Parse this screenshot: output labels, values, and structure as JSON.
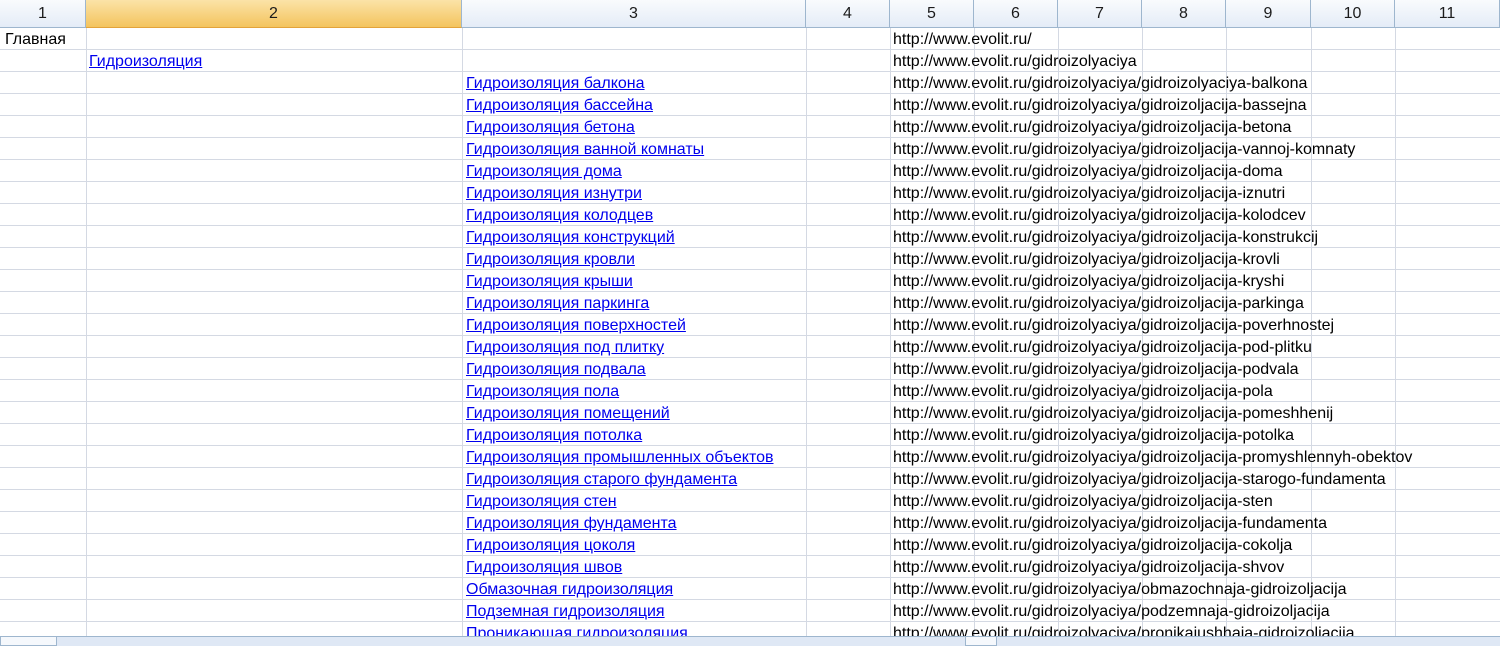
{
  "columns": [
    "1",
    "2",
    "3",
    "4",
    "5",
    "6",
    "7",
    "8",
    "9",
    "10",
    "11"
  ],
  "selected_column": "2",
  "rows": [
    {
      "c1": "Главная",
      "c2": "",
      "c3": "",
      "url": "http://www.evolit.ru/"
    },
    {
      "c1": "",
      "c2": "Гидроизоляция",
      "c3": "",
      "url": "http://www.evolit.ru/gidroizolyaciya"
    },
    {
      "c1": "",
      "c2": "",
      "c3": "Гидроизоляция балкона",
      "url": "http://www.evolit.ru/gidroizolyaciya/gidroizolyaciya-balkona"
    },
    {
      "c1": "",
      "c2": "",
      "c3": "Гидроизоляция бассейна",
      "url": "http://www.evolit.ru/gidroizolyaciya/gidroizoljacija-bassejna"
    },
    {
      "c1": "",
      "c2": "",
      "c3": "Гидроизоляция бетона",
      "url": "http://www.evolit.ru/gidroizolyaciya/gidroizoljacija-betona"
    },
    {
      "c1": "",
      "c2": "",
      "c3": "Гидроизоляция ванной комнаты",
      "url": "http://www.evolit.ru/gidroizolyaciya/gidroizoljacija-vannoj-komnaty"
    },
    {
      "c1": "",
      "c2": "",
      "c3": "Гидроизоляция дома",
      "url": "http://www.evolit.ru/gidroizolyaciya/gidroizoljacija-doma"
    },
    {
      "c1": "",
      "c2": "",
      "c3": "Гидроизоляция изнутри",
      "url": "http://www.evolit.ru/gidroizolyaciya/gidroizoljacija-iznutri"
    },
    {
      "c1": "",
      "c2": "",
      "c3": "Гидроизоляция колодцев",
      "url": "http://www.evolit.ru/gidroizolyaciya/gidroizoljacija-kolodcev"
    },
    {
      "c1": "",
      "c2": "",
      "c3": "Гидроизоляция конструкций",
      "url": "http://www.evolit.ru/gidroizolyaciya/gidroizoljacija-konstrukcij"
    },
    {
      "c1": "",
      "c2": "",
      "c3": "Гидроизоляция кровли",
      "url": "http://www.evolit.ru/gidroizolyaciya/gidroizoljacija-krovli"
    },
    {
      "c1": "",
      "c2": "",
      "c3": "Гидроизоляция крыши",
      "url": "http://www.evolit.ru/gidroizolyaciya/gidroizoljacija-kryshi"
    },
    {
      "c1": "",
      "c2": "",
      "c3": "Гидроизоляция паркинга",
      "url": "http://www.evolit.ru/gidroizolyaciya/gidroizoljacija-parkinga"
    },
    {
      "c1": "",
      "c2": "",
      "c3": "Гидроизоляция поверхностей",
      "url": "http://www.evolit.ru/gidroizolyaciya/gidroizoljacija-poverhnostej"
    },
    {
      "c1": "",
      "c2": "",
      "c3": "Гидроизоляция под плитку",
      "url": "http://www.evolit.ru/gidroizolyaciya/gidroizoljacija-pod-plitku"
    },
    {
      "c1": "",
      "c2": "",
      "c3": "Гидроизоляция подвала",
      "url": "http://www.evolit.ru/gidroizolyaciya/gidroizoljacija-podvala"
    },
    {
      "c1": "",
      "c2": "",
      "c3": "Гидроизоляция пола",
      "url": "http://www.evolit.ru/gidroizolyaciya/gidroizoljacija-pola"
    },
    {
      "c1": "",
      "c2": "",
      "c3": "Гидроизоляция помещений",
      "url": "http://www.evolit.ru/gidroizolyaciya/gidroizoljacija-pomeshhenij"
    },
    {
      "c1": "",
      "c2": "",
      "c3": "Гидроизоляция потолка",
      "url": "http://www.evolit.ru/gidroizolyaciya/gidroizoljacija-potolka"
    },
    {
      "c1": "",
      "c2": "",
      "c3": "Гидроизоляция промышленных объектов",
      "url": "http://www.evolit.ru/gidroizolyaciya/gidroizoljacija-promyshlennyh-obektov"
    },
    {
      "c1": "",
      "c2": "",
      "c3": "Гидроизоляция старого фундамента",
      "url": "http://www.evolit.ru/gidroizolyaciya/gidroizoljacija-starogo-fundamenta"
    },
    {
      "c1": "",
      "c2": "",
      "c3": "Гидроизоляция стен",
      "url": "http://www.evolit.ru/gidroizolyaciya/gidroizoljacija-sten"
    },
    {
      "c1": "",
      "c2": "",
      "c3": "Гидроизоляция фундамента",
      "url": "http://www.evolit.ru/gidroizolyaciya/gidroizoljacija-fundamenta"
    },
    {
      "c1": "",
      "c2": "",
      "c3": "Гидроизоляция цоколя",
      "url": "http://www.evolit.ru/gidroizolyaciya/gidroizoljacija-cokolja"
    },
    {
      "c1": "",
      "c2": "",
      "c3": "Гидроизоляция швов",
      "url": "http://www.evolit.ru/gidroizolyaciya/gidroizoljacija-shvov"
    },
    {
      "c1": "",
      "c2": "",
      "c3": "Обмазочная гидроизоляция",
      "url": "http://www.evolit.ru/gidroizolyaciya/obmazochnaja-gidroizoljacija"
    },
    {
      "c1": "",
      "c2": "",
      "c3": "Подземная гидроизоляция",
      "url": "http://www.evolit.ru/gidroizolyaciya/podzemnaja-gidroizoljacija"
    },
    {
      "c1": "",
      "c2": "",
      "c3": "Проникающая гидроизоляция",
      "url": "http://www.evolit.ru/gidroizolyaciya/pronikajushhaja-gidroizoljacija"
    }
  ],
  "colors": {
    "link": "#0000ee",
    "selected_header": "#f4c45e",
    "gridline": "#d4d9e3"
  }
}
